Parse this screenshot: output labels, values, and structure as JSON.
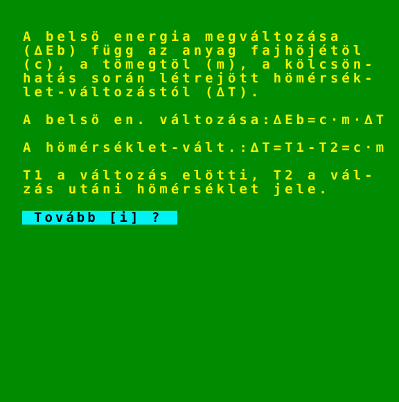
{
  "text": {
    "line1": "A belsö energia megváltozása",
    "line2": "(∆Eb) függ az anyag fajhöjétöl",
    "line3": "(c), a tömegtöl (m), a kölcsön-",
    "line4": "hatás során létrejött hömérsék-",
    "line5": "let-változástól (∆T).",
    "line6": "A belsö en. változása:∆Eb=c·m·∆T",
    "line7": "A hömérséklet-vált.:∆T=T1-T2=c·m",
    "line8": "T1 a változás elötti, T2 a vál-",
    "line9": "zás utáni hömérséklet jele."
  },
  "prompt": {
    "label": "Tovább [i] ?"
  },
  "colors": {
    "background": "#008c00",
    "text": "#f2f200",
    "prompt_background": "#00f2f2",
    "prompt_text": "#000000"
  }
}
